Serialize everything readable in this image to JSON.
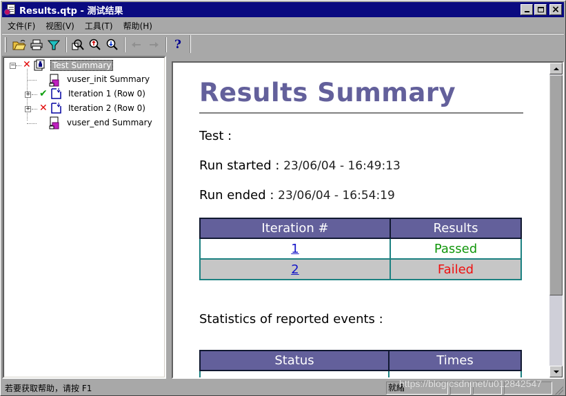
{
  "window": {
    "title": "Results.qtp - 测试结果",
    "controls": {
      "minimize": "_",
      "maximize": "□",
      "close": "×"
    }
  },
  "menu": [
    {
      "label": "文件(F)"
    },
    {
      "label": "视图(V)"
    },
    {
      "label": "工具(T)"
    },
    {
      "label": "帮助(H)"
    }
  ],
  "toolbar": {
    "buttons": [
      {
        "icon": "open-folder-icon"
      },
      {
        "icon": "print-icon"
      },
      {
        "icon": "filter-icon"
      },
      {
        "icon": "find-icon"
      },
      {
        "icon": "find-previous-icon"
      },
      {
        "icon": "find-next-icon"
      },
      {
        "icon": "back-arrow-icon"
      },
      {
        "icon": "forward-arrow-icon"
      },
      {
        "icon": "help-icon",
        "glyph": "?"
      }
    ]
  },
  "tree": {
    "nodes": [
      {
        "label": "Test  Summary",
        "status": "failed",
        "status_glyph": "✕",
        "expander": "−",
        "selected": true
      },
      {
        "label": "vuser_init Summary"
      },
      {
        "label": "Iteration 1 (Row 0)",
        "status": "passed",
        "status_glyph": "✔",
        "expander": "+"
      },
      {
        "label": "Iteration 2 (Row 0)",
        "status": "failed",
        "status_glyph": "✕",
        "expander": "+"
      },
      {
        "label": "vuser_end Summary"
      }
    ]
  },
  "report": {
    "title": "Results Summary",
    "test_label": "Test :",
    "run_started_label": "Run started :",
    "run_started_value": "23/06/04 - 16:49:13",
    "run_ended_label": "Run ended :",
    "run_ended_value": "23/06/04 - 16:54:19",
    "iterations_table": {
      "headers": [
        "Iteration #",
        "Results"
      ],
      "rows": [
        {
          "iteration": "1",
          "result": "Passed"
        },
        {
          "iteration": "2",
          "result": "Failed"
        }
      ]
    },
    "stats_heading": "Statistics of reported events :",
    "stats_table": {
      "headers": [
        "Status",
        "Times"
      ]
    }
  },
  "colors": {
    "accent": "#63609b",
    "passed": "#10960a",
    "failed": "#f01010",
    "title_bar": "#0a0a80"
  },
  "statusbar": {
    "help_text": "若要获取帮助，请按 F1",
    "state": "就緒",
    "watermark": "https://blog.csdn.net/u012842547"
  }
}
